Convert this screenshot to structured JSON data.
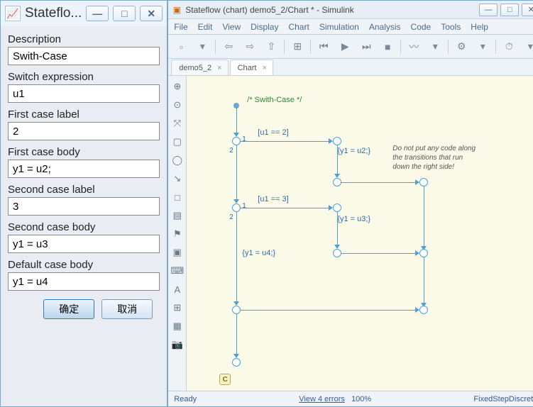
{
  "dialog": {
    "title": "Stateflo...",
    "fields": [
      {
        "label": "Description",
        "value": "Swith-Case"
      },
      {
        "label": "Switch expression",
        "value": "u1"
      },
      {
        "label": "First case label",
        "value": "2"
      },
      {
        "label": "First case body",
        "value": "y1 = u2;"
      },
      {
        "label": "Second case label",
        "value": "3"
      },
      {
        "label": "Second case body",
        "value": "y1 = u3"
      },
      {
        "label": "Default case body",
        "value": "y1 = u4"
      }
    ],
    "ok": "确定",
    "cancel": "取消"
  },
  "window": {
    "title": "Stateflow (chart) demo5_2/Chart * - Simulink",
    "menu": [
      "File",
      "Edit",
      "View",
      "Display",
      "Chart",
      "Simulation",
      "Analysis",
      "Code",
      "Tools",
      "Help"
    ],
    "tabs": [
      {
        "label": "demo5_2",
        "active": false
      },
      {
        "label": "Chart",
        "active": true
      }
    ],
    "chart": {
      "comment": "/* Swith-Case */",
      "guard1": "[u1 == 2]",
      "action1": "{y1 = u2;}",
      "guard2": "[u1 == 3]",
      "action2": "{y1 = u3;}",
      "action3": "{y1 = u4;}",
      "junction_priorities": [
        "1",
        "2",
        "1",
        "2"
      ],
      "note": "Do not put any code along\nthe transitions that run\ndown the right side!",
      "badge": "C"
    },
    "status": {
      "ready": "Ready",
      "errors": "View 4 errors",
      "zoom": "100%",
      "solver": "FixedStepDiscrete"
    }
  },
  "icons": {
    "minimize": "—",
    "maximize": "□",
    "close": "✕",
    "back": "⇦",
    "fwd": "⇨",
    "up": "⇧",
    "find": "⌕",
    "play": "▶",
    "stop": "■",
    "step_fwd": "⏭",
    "rec": "●",
    "gear": "⚙",
    "clock": "⏱",
    "palette": [
      "⊕",
      "⊙",
      "⤧",
      "▢",
      "◯",
      "↘",
      "□",
      "▤",
      "⚑",
      "▣",
      "⌨",
      "A",
      "⊞",
      "▦",
      "📷"
    ]
  }
}
